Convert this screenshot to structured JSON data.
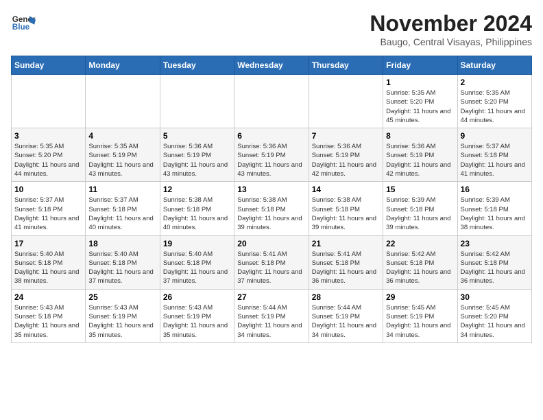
{
  "header": {
    "logo_line1": "General",
    "logo_line2": "Blue",
    "month_year": "November 2024",
    "location": "Baugo, Central Visayas, Philippines"
  },
  "weekdays": [
    "Sunday",
    "Monday",
    "Tuesday",
    "Wednesday",
    "Thursday",
    "Friday",
    "Saturday"
  ],
  "weeks": [
    [
      {
        "day": "",
        "info": ""
      },
      {
        "day": "",
        "info": ""
      },
      {
        "day": "",
        "info": ""
      },
      {
        "day": "",
        "info": ""
      },
      {
        "day": "",
        "info": ""
      },
      {
        "day": "1",
        "info": "Sunrise: 5:35 AM\nSunset: 5:20 PM\nDaylight: 11 hours and 45 minutes."
      },
      {
        "day": "2",
        "info": "Sunrise: 5:35 AM\nSunset: 5:20 PM\nDaylight: 11 hours and 44 minutes."
      }
    ],
    [
      {
        "day": "3",
        "info": "Sunrise: 5:35 AM\nSunset: 5:20 PM\nDaylight: 11 hours and 44 minutes."
      },
      {
        "day": "4",
        "info": "Sunrise: 5:35 AM\nSunset: 5:19 PM\nDaylight: 11 hours and 43 minutes."
      },
      {
        "day": "5",
        "info": "Sunrise: 5:36 AM\nSunset: 5:19 PM\nDaylight: 11 hours and 43 minutes."
      },
      {
        "day": "6",
        "info": "Sunrise: 5:36 AM\nSunset: 5:19 PM\nDaylight: 11 hours and 43 minutes."
      },
      {
        "day": "7",
        "info": "Sunrise: 5:36 AM\nSunset: 5:19 PM\nDaylight: 11 hours and 42 minutes."
      },
      {
        "day": "8",
        "info": "Sunrise: 5:36 AM\nSunset: 5:19 PM\nDaylight: 11 hours and 42 minutes."
      },
      {
        "day": "9",
        "info": "Sunrise: 5:37 AM\nSunset: 5:18 PM\nDaylight: 11 hours and 41 minutes."
      }
    ],
    [
      {
        "day": "10",
        "info": "Sunrise: 5:37 AM\nSunset: 5:18 PM\nDaylight: 11 hours and 41 minutes."
      },
      {
        "day": "11",
        "info": "Sunrise: 5:37 AM\nSunset: 5:18 PM\nDaylight: 11 hours and 40 minutes."
      },
      {
        "day": "12",
        "info": "Sunrise: 5:38 AM\nSunset: 5:18 PM\nDaylight: 11 hours and 40 minutes."
      },
      {
        "day": "13",
        "info": "Sunrise: 5:38 AM\nSunset: 5:18 PM\nDaylight: 11 hours and 39 minutes."
      },
      {
        "day": "14",
        "info": "Sunrise: 5:38 AM\nSunset: 5:18 PM\nDaylight: 11 hours and 39 minutes."
      },
      {
        "day": "15",
        "info": "Sunrise: 5:39 AM\nSunset: 5:18 PM\nDaylight: 11 hours and 39 minutes."
      },
      {
        "day": "16",
        "info": "Sunrise: 5:39 AM\nSunset: 5:18 PM\nDaylight: 11 hours and 38 minutes."
      }
    ],
    [
      {
        "day": "17",
        "info": "Sunrise: 5:40 AM\nSunset: 5:18 PM\nDaylight: 11 hours and 38 minutes."
      },
      {
        "day": "18",
        "info": "Sunrise: 5:40 AM\nSunset: 5:18 PM\nDaylight: 11 hours and 37 minutes."
      },
      {
        "day": "19",
        "info": "Sunrise: 5:40 AM\nSunset: 5:18 PM\nDaylight: 11 hours and 37 minutes."
      },
      {
        "day": "20",
        "info": "Sunrise: 5:41 AM\nSunset: 5:18 PM\nDaylight: 11 hours and 37 minutes."
      },
      {
        "day": "21",
        "info": "Sunrise: 5:41 AM\nSunset: 5:18 PM\nDaylight: 11 hours and 36 minutes."
      },
      {
        "day": "22",
        "info": "Sunrise: 5:42 AM\nSunset: 5:18 PM\nDaylight: 11 hours and 36 minutes."
      },
      {
        "day": "23",
        "info": "Sunrise: 5:42 AM\nSunset: 5:18 PM\nDaylight: 11 hours and 36 minutes."
      }
    ],
    [
      {
        "day": "24",
        "info": "Sunrise: 5:43 AM\nSunset: 5:18 PM\nDaylight: 11 hours and 35 minutes."
      },
      {
        "day": "25",
        "info": "Sunrise: 5:43 AM\nSunset: 5:19 PM\nDaylight: 11 hours and 35 minutes."
      },
      {
        "day": "26",
        "info": "Sunrise: 5:43 AM\nSunset: 5:19 PM\nDaylight: 11 hours and 35 minutes."
      },
      {
        "day": "27",
        "info": "Sunrise: 5:44 AM\nSunset: 5:19 PM\nDaylight: 11 hours and 34 minutes."
      },
      {
        "day": "28",
        "info": "Sunrise: 5:44 AM\nSunset: 5:19 PM\nDaylight: 11 hours and 34 minutes."
      },
      {
        "day": "29",
        "info": "Sunrise: 5:45 AM\nSunset: 5:19 PM\nDaylight: 11 hours and 34 minutes."
      },
      {
        "day": "30",
        "info": "Sunrise: 5:45 AM\nSunset: 5:20 PM\nDaylight: 11 hours and 34 minutes."
      }
    ]
  ]
}
